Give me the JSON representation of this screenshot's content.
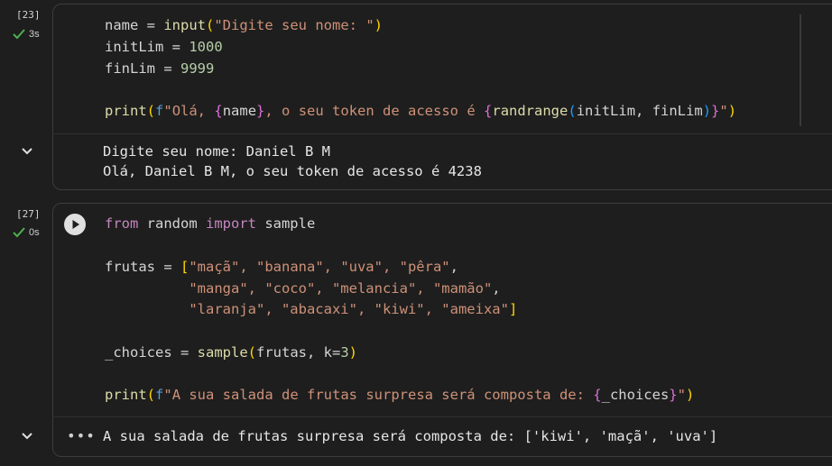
{
  "cell1": {
    "exec_count": "[23]",
    "duration": "3s",
    "code_lines": [
      "name = input(\"Digite seu nome: \")",
      "initLim = 1000",
      "finLim = 9999",
      "",
      "print(f\"Olá, {name}, o seu token de acesso é {randrange(initLim, finLim)}\")"
    ],
    "code": {
      "l1_name": "name",
      "l1_eq": " = ",
      "l1_fn": "input",
      "l1_open": "(",
      "l1_str": "\"Digite seu nome: \"",
      "l1_close": ")",
      "l2_var": "initLim",
      "l2_eq": " = ",
      "l2_num": "1000",
      "l3_var": "finLim",
      "l3_eq": " = ",
      "l3_num": "9999",
      "l5_fn": "print",
      "l5_open": "(",
      "l5_f": "f",
      "l5_s1": "\"Olá, ",
      "l5_b1o": "{",
      "l5_name": "name",
      "l5_b1c": "}",
      "l5_s2": ", o seu token de acesso é ",
      "l5_b2o": "{",
      "l5_fn2": "randrange",
      "l5_p2o": "(",
      "l5_args": "initLim, finLim",
      "l5_p2c": ")",
      "l5_b2c": "}",
      "l5_s3": "\"",
      "l5_close": ")"
    },
    "output_lines": [
      "Digite seu nome: Daniel B M",
      "Olá, Daniel B M, o seu token de acesso é 4238"
    ]
  },
  "cell2": {
    "exec_count": "[27]",
    "duration": "0s",
    "code_lines": [
      "from random import sample",
      "",
      "frutas = [\"maçã\", \"banana\", \"uva\", \"pêra\",",
      "          \"manga\", \"coco\", \"melancia\", \"mamão\",",
      "          \"laranja\", \"abacaxi\", \"kiwi\", \"ameixa\"]",
      "",
      "_choices = sample(frutas, k=3)",
      "",
      "print(f\"A sua salada de frutas surpresa será composta de: {_choices}\")"
    ],
    "code": {
      "l1_from": "from",
      "l1_mod": " random ",
      "l1_import": "import",
      "l1_name": " sample",
      "l3_var": "frutas = ",
      "l3_bo": "[",
      "l3_items": "\"maçã\", \"banana\", \"uva\", \"pêra\"",
      "l3_comma": ",",
      "l4_pad": "          ",
      "l4_items": "\"manga\", \"coco\", \"melancia\", \"mamão\"",
      "l4_comma": ",",
      "l5_pad": "          ",
      "l5_items": "\"laranja\", \"abacaxi\", \"kiwi\", \"ameixa\"",
      "l5_bc": "]",
      "l7_var": "_choices = ",
      "l7_fn": "sample",
      "l7_po": "(",
      "l7_args": "frutas, k=",
      "l7_num": "3",
      "l7_pc": ")",
      "l9_fn": "print",
      "l9_po": "(",
      "l9_f": "f",
      "l9_s1": "\"A sua salada de frutas surpresa será composta de: ",
      "l9_bo": "{",
      "l9_var": "_choices",
      "l9_bc": "}",
      "l9_s2": "\"",
      "l9_pc": ")"
    },
    "output_text": "A sua salada de frutas surpresa será composta de: ['kiwi', 'maçã', 'uva']"
  },
  "icons": {
    "check": "check-icon",
    "collapse": "chevron-down-icon",
    "run": "play-icon",
    "more": "more-horizontal-icon"
  },
  "colors": {
    "background": "#1e1e1e",
    "keyword": "#c586c0",
    "function": "#dcdcaa",
    "string": "#ce9178",
    "number": "#b5cea8",
    "success": "#4caf50"
  }
}
